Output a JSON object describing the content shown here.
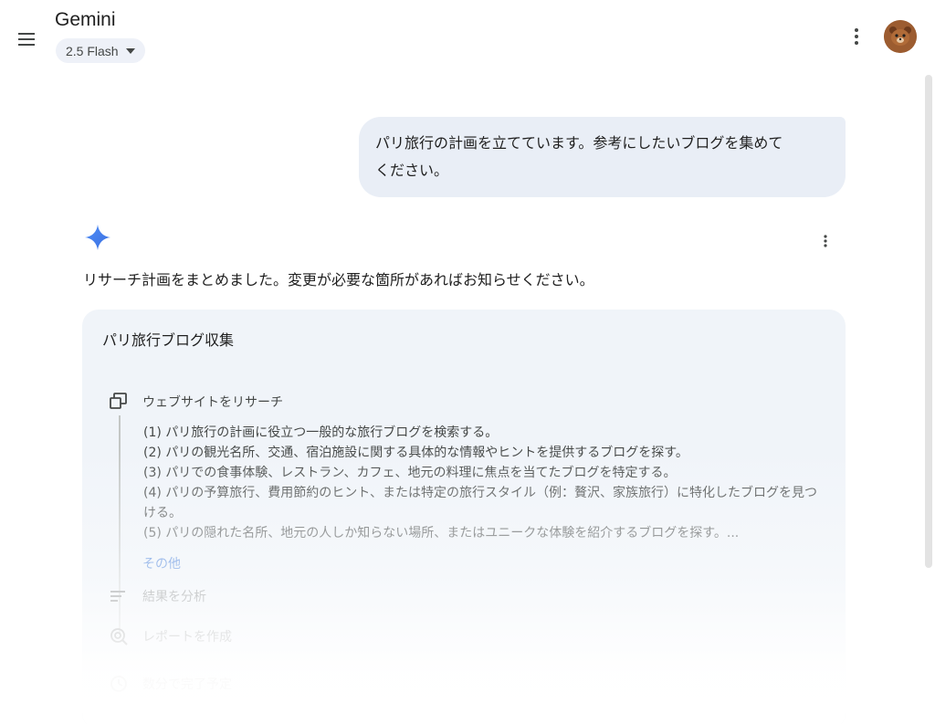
{
  "app": {
    "title": "Gemini",
    "model": "2.5 Flash"
  },
  "icons": {
    "menu": "menu-icon",
    "more": "more-vert-icon",
    "avatar": "bear-avatar",
    "spark": "gemini-spark-icon",
    "step_web": "web-research-icon",
    "step_analyze": "analyze-icon",
    "step_report": "report-icon",
    "step_time": "clock-icon"
  },
  "colors": {
    "accent": "#0b57d0",
    "user_bubble": "#e9eef6",
    "card": "#f0f4f9"
  },
  "conversation": {
    "user_message_line1": "パリ旅行の計画を立てています。参考にしたいブログを集めて",
    "user_message_line2": "ください。",
    "response_text": "リサーチ計画をまとめました。変更が必要な箇所があればお知らせください。"
  },
  "plan": {
    "title": "パリ旅行ブログ収集",
    "step1_label": "ウェブサイトをリサーチ",
    "items": [
      "(1) パリ旅行の計画に役立つ一般的な旅行ブログを検索する。",
      "(2) パリの観光名所、交通、宿泊施設に関する具体的な情報やヒントを提供するブログを探す。",
      "(3) パリでの食事体験、レストラン、カフェ、地元の料理に焦点を当てたブログを特定する。",
      "(4) パリの予算旅行、費用節約のヒント、または特定の旅行スタイル（例：贅沢、家族旅行）に特化したブログを見つける。",
      "(5) パリの隠れた名所、地元の人しか知らない場所、またはユニークな体験を紹介するブログを探す。..."
    ],
    "more_label": "その他",
    "step2_label": "結果を分析",
    "step3_label": "レポートを作成",
    "step4_label": "数分で完了予定"
  }
}
